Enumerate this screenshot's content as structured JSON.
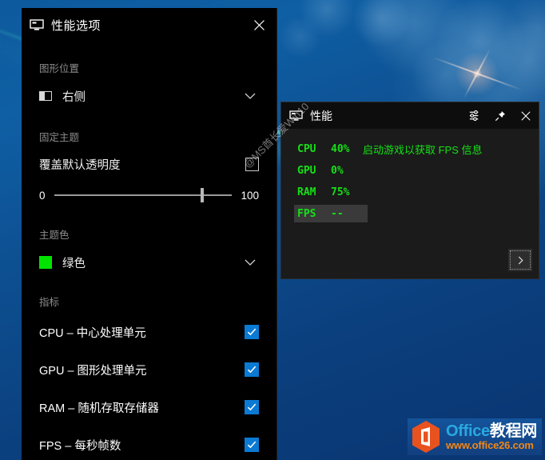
{
  "options_panel": {
    "title": "性能选项",
    "title_icon": "monitor-icon",
    "close_icon": "close-icon",
    "graphics_position": {
      "section_label": "图形位置",
      "value": "右侧",
      "icon": "position-right-icon",
      "chevron": "chevron-down-icon"
    },
    "pin_theme": {
      "section_label": "固定主题",
      "override_opacity_label": "覆盖默认透明度",
      "override_opacity_checked": false,
      "slider": {
        "min_label": "0",
        "max_label": "100",
        "value": 83
      }
    },
    "theme_color": {
      "section_label": "主题色",
      "value": "绿色",
      "swatch_hex": "#00E400",
      "chevron": "chevron-down-icon"
    },
    "metrics": {
      "section_label": "指标",
      "items": [
        {
          "label": "CPU – 中心处理单元",
          "checked": true
        },
        {
          "label": "GPU – 图形处理单元",
          "checked": true
        },
        {
          "label": "RAM – 随机存取存储器",
          "checked": true
        },
        {
          "label": "FPS – 每秒帧数",
          "checked": true
        }
      ]
    }
  },
  "perf_panel": {
    "title": "性能",
    "title_icon": "monitor-icon",
    "actions": [
      {
        "name": "settings-icon",
        "label": "设置"
      },
      {
        "name": "pin-icon",
        "label": "固定"
      },
      {
        "name": "close-icon",
        "label": "关闭"
      }
    ],
    "stats": [
      {
        "key": "CPU",
        "value": "40%",
        "highlighted": false
      },
      {
        "key": "GPU",
        "value": "0%",
        "highlighted": false
      },
      {
        "key": "RAM",
        "value": "75%",
        "highlighted": false
      },
      {
        "key": "FPS",
        "value": "--",
        "highlighted": true
      }
    ],
    "fps_message": "启动游戏以获取 FPS 信息",
    "next_button_icon": "chevron-right-icon",
    "accent_hex": "#16E016"
  },
  "watermark": {
    "text": "@MS酋长爱Win10"
  },
  "logo": {
    "line1_en": "Office",
    "line1_cn": "教程网",
    "line2": "www.office26.com"
  }
}
